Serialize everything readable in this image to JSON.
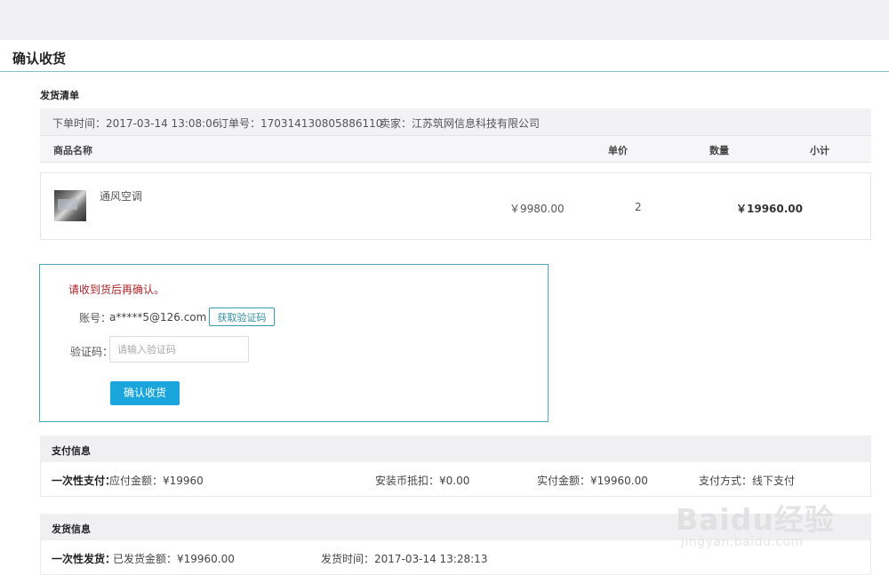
{
  "page": {
    "title": "确认收货"
  },
  "shipping_list": {
    "section_title": "发货清单",
    "order_time": "下单时间：2017-03-14 13:08:06",
    "order_no": "订单号：170314130805886110",
    "seller": "卖家：江苏筑网信息科技有限公司",
    "columns": {
      "name": "商品名称",
      "unit_price": "单价",
      "quantity": "数量",
      "subtotal": "小计"
    },
    "item": {
      "name": "通风空调",
      "price": "￥9980.00",
      "quantity": "2",
      "subtotal": "￥19960.00"
    }
  },
  "confirm": {
    "notice": "请收到货后再确认。",
    "account_label": "账号：",
    "account_value": "a*****5@126.com",
    "get_code_button": "获取验证码",
    "code_label": "验证码：",
    "code_placeholder": "请输入验证码",
    "code_value": "",
    "confirm_button": "确认收货"
  },
  "payment": {
    "section_title": "支付信息",
    "type": "一次性支付：",
    "payable": "应付金额：¥19960",
    "coin_deduction": "安装币抵扣：¥0.00",
    "paid": "实付金额：¥19960.00",
    "method": "支付方式：线下支付"
  },
  "delivery": {
    "section_title": "发货信息",
    "type": "一次性发货：",
    "shipped_amount": "已发货金额：¥19960.00",
    "ship_time": "发货时间：2017-03-14 13:28:13"
  },
  "watermark": {
    "logo": "Baidu经验",
    "url": "jingyan.baidu.com"
  },
  "colors": {
    "accent": "#1aa6dc",
    "border_accent": "#4aa9b8",
    "notice": "#b0242a"
  }
}
